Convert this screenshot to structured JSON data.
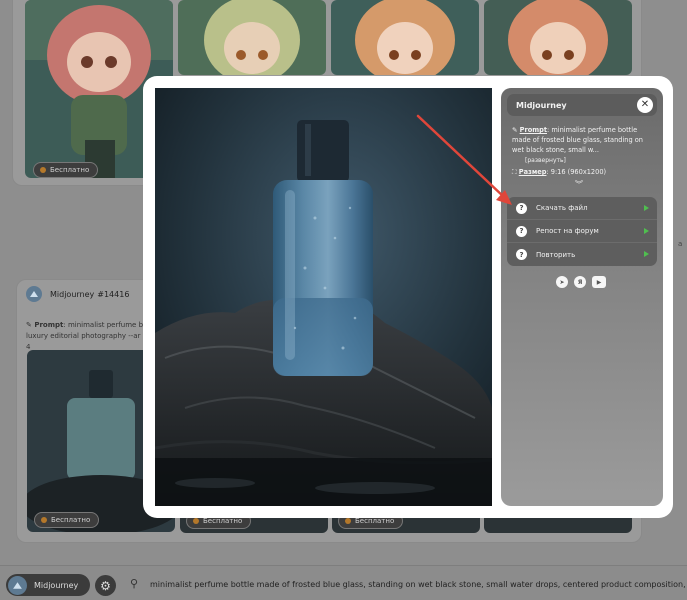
{
  "background": {
    "cards_top": {
      "badges": [
        "Бесплатно"
      ]
    },
    "card2": {
      "model": "Midjourney",
      "id": "#14416",
      "prompt_label": "Prompt",
      "prompt_snippet_1": "minimalist perfume b",
      "prompt_snippet_2": "luxury editorial photography --ar 4",
      "badges": [
        "Бесплатно",
        "Бесплатно",
        "Бесплатно"
      ]
    },
    "side_fragment": "a"
  },
  "bottom_bar": {
    "model_label": "Midjourney",
    "prompt_text": "minimalist perfume bottle made of frosted blue glass, standing on wet black stone, small water drops, centered product composition, soft side ligh"
  },
  "modal": {
    "title": "Midjourney",
    "close_symbol": "✕",
    "prompt_label": "Prompt",
    "prompt_text": "minimalist perfume bottle made of frosted blue glass, standing on wet black stone, small w...",
    "expand_label": "[развернуть]",
    "size_label": "Размер",
    "size_value": "9:16 (960x1200)",
    "actions": [
      {
        "label": "Скачать файл"
      },
      {
        "label": "Репост на форум"
      },
      {
        "label": "Повторить"
      }
    ],
    "socials": [
      "telegram",
      "yandex",
      "youtube"
    ],
    "colors": {
      "accent_arrow": "#e0463a",
      "play_green": "#4fbf4f"
    }
  }
}
